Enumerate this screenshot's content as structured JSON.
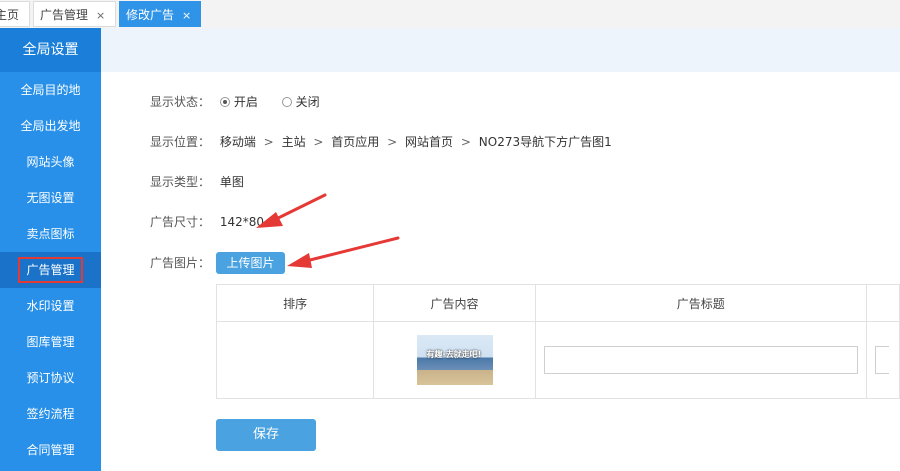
{
  "tabs": [
    {
      "label": "主页"
    },
    {
      "label": "广告管理",
      "close": "×"
    },
    {
      "label": "修改广告",
      "close": "×"
    }
  ],
  "sidebar": {
    "header": "全局设置",
    "items": [
      {
        "label": "全局目的地"
      },
      {
        "label": "全局出发地"
      },
      {
        "label": "网站头像"
      },
      {
        "label": "无图设置"
      },
      {
        "label": "卖点图标"
      },
      {
        "label": "广告管理"
      },
      {
        "label": "水印设置"
      },
      {
        "label": "图库管理"
      },
      {
        "label": "预订协议"
      },
      {
        "label": "签约流程"
      },
      {
        "label": "合同管理"
      }
    ]
  },
  "form": {
    "status_label": "显示状态：",
    "status_on": "开启",
    "status_off": "关闭",
    "position_label": "显示位置：",
    "position_path": [
      "移动端",
      "主站",
      "首页应用",
      "网站首页",
      "NO273导航下方广告图1"
    ],
    "position_sep": ">",
    "type_label": "显示类型：",
    "type_value": "单图",
    "size_label": "广告尺寸：",
    "size_value": "142*80",
    "image_label": "广告图片：",
    "upload_label": "上传图片"
  },
  "table": {
    "headers": [
      "排序",
      "广告内容",
      "广告标题"
    ],
    "thumb_text": "有趣·去就走吧!"
  },
  "save_label": "保存",
  "colors": {
    "accent": "#2f93e7",
    "sidebar": "#2890e8",
    "button": "#4aa3e0",
    "annotation": "#e53935"
  }
}
